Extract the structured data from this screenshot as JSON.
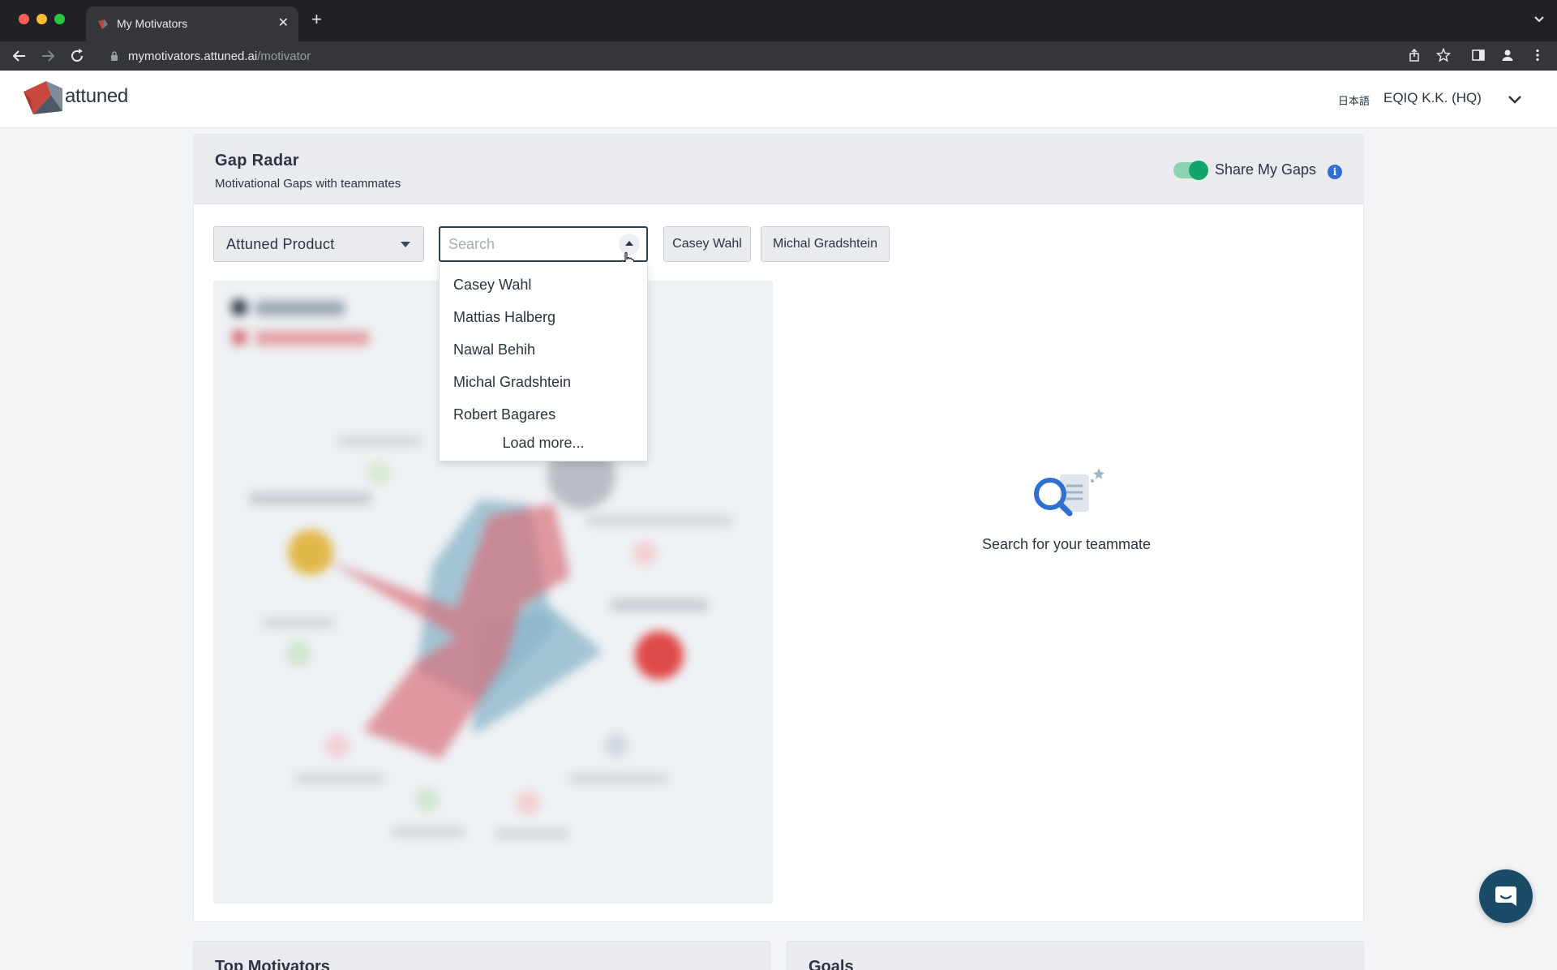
{
  "browser": {
    "tab_title": "My Motivators",
    "url_host": "mymotivators.attuned.ai",
    "url_path": "/motivator",
    "new_tab": "+",
    "close": "✕"
  },
  "header": {
    "logo_text": "attuned",
    "language": "日本語",
    "org_name": "EQIQ K.K. (HQ)"
  },
  "gap_radar": {
    "title": "Gap Radar",
    "subtitle": "Motivational Gaps with teammates",
    "share_label": "Share My Gaps",
    "share_enabled": true,
    "info": "i",
    "team_select": "Attuned Product",
    "search_placeholder": "Search",
    "search_value": "",
    "selected_chips": [
      "Casey Wahl",
      "Michal Gradshtein"
    ],
    "dropdown": {
      "items": [
        "Casey Wahl",
        "Mattias Halberg",
        "Nawal Behih",
        "Michal Gradshtein",
        "Robert Bagares"
      ],
      "load_more": "Load more..."
    },
    "empty_state": "Search for your teammate"
  },
  "lower_cards": {
    "left_title": "Top Motivators",
    "right_title": "Goals"
  },
  "colors": {
    "accent_green": "#12a56b",
    "info_blue": "#2f6fd1",
    "chat_button": "#1a4a66",
    "radar_red": "#d9707a",
    "radar_blue": "#8ab4c8"
  }
}
